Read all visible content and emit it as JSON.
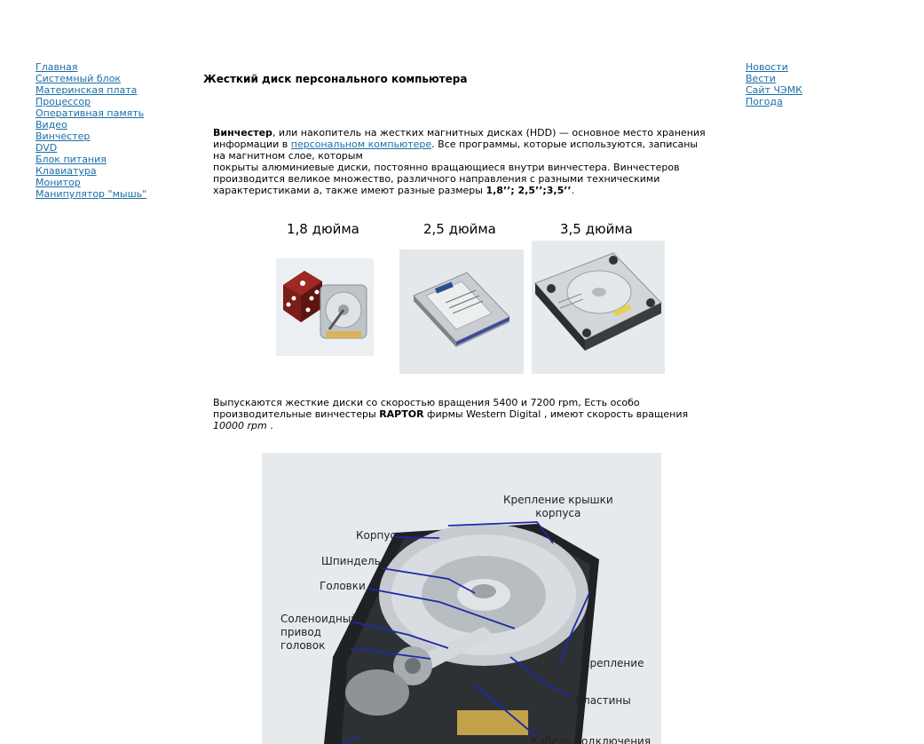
{
  "nav_left": [
    "Главная",
    "Системный блок",
    "Материнская плата",
    "Процессор",
    "Оперативная память",
    "Видео",
    "Винчестер",
    "DVD",
    "Блок питания",
    "Клавиатура",
    "Монитор",
    "Манипулятор \"мышь\""
  ],
  "nav_right": [
    "Новости",
    "Вести",
    "Сайт ЧЭМК",
    "Погода"
  ],
  "title": "Жесткий диск персонального компьютера",
  "para1": {
    "term": "Винчестер",
    "t1": ", или накопитель на жестких магнитных дисках (HDD) — основное место хранения информации в ",
    "link": "персональном компьютере",
    "t2": ". Все программы, которые используются, записаны на магнитном слое, которым",
    "t3": "покрыты алюминиевые диски, постоянно вращающиеся внутри винчестера. Винчестеров производится великое множество, различного направления с разными техническими характеристиками а, также имеют разные размеры ",
    "sizes": "1,8’’; 2,5’’;3,5’’",
    "end": "."
  },
  "sizes": [
    {
      "label": "1,8 дюйма"
    },
    {
      "label": "2,5 дюйма"
    },
    {
      "label": "3,5 дюйма"
    }
  ],
  "para2": {
    "t1": "Выпускаются жесткие диски со скоростью вращения 5400 и 7200 rpm,  Есть особо производительные винчестеры ",
    "brand": "RAPTOR",
    "t2": " фирмы Western Digital , имеют скорость вращения ",
    "speed": "10000 rpm",
    "end": " ."
  },
  "diagram": {
    "labels": {
      "cover": "Крепление крышки\nкорпуса",
      "case": "Корпус",
      "spindle": "Шпиндель",
      "heads": "Головки",
      "actuator": "Соленоидный\nпривод\nголовок",
      "mount": "Крепление",
      "platters": "Пластины",
      "cable": "Кабель подключения"
    }
  },
  "colors": {
    "link": "#1a6fa8",
    "diagram_bg": "#e6eaed",
    "pointer": "#1d2aa8"
  }
}
